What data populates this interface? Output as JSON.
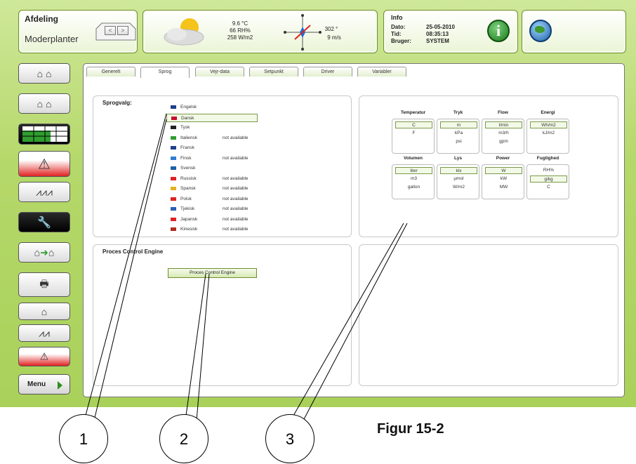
{
  "header": {
    "department_label": "Afdeling",
    "department_value": "Moderplanter",
    "weather": {
      "temperature": "9.6 °C",
      "humidity": "66 RH%",
      "radiation": "258 W/m2",
      "wind_direction": "302 °",
      "wind_speed": "9 m/s"
    },
    "info": {
      "title": "Info",
      "date_label": "Dato:",
      "date_value": "25-05-2010",
      "time_label": "Tid:",
      "time_value": "08:35:13",
      "user_label": "Bruger:",
      "user_value": "SYSTEM"
    }
  },
  "sidebar": {
    "menu_label": "Menu"
  },
  "tabs": [
    "Generelt",
    "Sprog",
    "Vejr-data",
    "Setpunkt",
    "Driver",
    "Variabler"
  ],
  "active_tab": "Sprog",
  "language_panel": {
    "title": "Sprogvalg:",
    "languages": [
      {
        "name": "Engelsk",
        "status": ""
      },
      {
        "name": "Dansk",
        "status": ""
      },
      {
        "name": "Tysk",
        "status": ""
      },
      {
        "name": "Italiensk",
        "status": "not available"
      },
      {
        "name": "Fransk",
        "status": ""
      },
      {
        "name": "Finsk",
        "status": "not available"
      },
      {
        "name": "Svensk",
        "status": ""
      },
      {
        "name": "Russisk",
        "status": "not available"
      },
      {
        "name": "Spansk",
        "status": "not available"
      },
      {
        "name": "Polsk",
        "status": "not available"
      },
      {
        "name": "Tjekisk",
        "status": "not available"
      },
      {
        "name": "Japansk",
        "status": "not available"
      },
      {
        "name": "Kinesisk",
        "status": "not available"
      }
    ],
    "selected": "Dansk"
  },
  "pce_panel": {
    "title": "Proces Control Engine",
    "button_label": "Proces Control Engine"
  },
  "units": {
    "groups": [
      {
        "name": "Temperatur",
        "options": [
          "C",
          "F"
        ],
        "selected": "C"
      },
      {
        "name": "Tryk",
        "options": [
          "m",
          "kPa",
          "psi"
        ],
        "selected": "m"
      },
      {
        "name": "Flow",
        "options": [
          "l/min",
          "m3/h",
          "gpm"
        ],
        "selected": "l/min"
      },
      {
        "name": "Energi",
        "options": [
          "Wh/m2",
          "kJ/m2"
        ],
        "selected": "Wh/m2"
      },
      {
        "name": "Volumen",
        "options": [
          "liter",
          "m3",
          "gallon"
        ],
        "selected": "liter"
      },
      {
        "name": "Lys",
        "options": [
          "klx",
          "µmol",
          "W/m2"
        ],
        "selected": "klx"
      },
      {
        "name": "Power",
        "options": [
          "W",
          "kW",
          "MW"
        ],
        "selected": "W"
      },
      {
        "name": "Fugtighed",
        "options": [
          "RH%",
          "g/kg",
          "C"
        ],
        "selected": "g/kg"
      }
    ]
  },
  "callouts": [
    "1",
    "2",
    "3"
  ],
  "figure_caption": "Figur 15-2"
}
